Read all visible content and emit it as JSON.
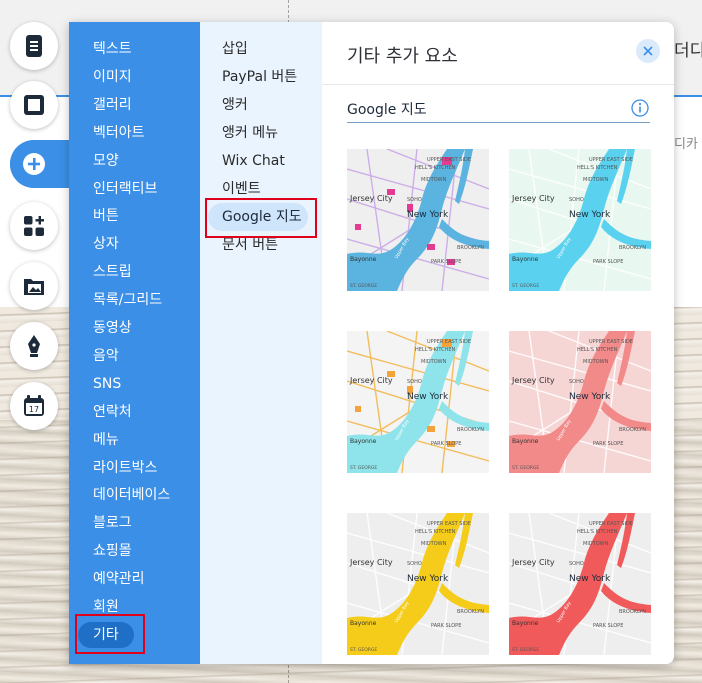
{
  "background": {
    "partial_text_top": "더디",
    "partial_text_mid": "디카"
  },
  "toolbar": {
    "buttons": [
      {
        "name": "pages-icon"
      },
      {
        "name": "background-icon"
      },
      {
        "name": "add-icon"
      },
      {
        "name": "app-market-icon"
      },
      {
        "name": "media-icon"
      },
      {
        "name": "pen-icon"
      },
      {
        "name": "bookings-icon"
      }
    ],
    "calendar_day": "17"
  },
  "categories": [
    "텍스트",
    "이미지",
    "갤러리",
    "벡터아트",
    "모양",
    "인터랙티브",
    "버튼",
    "상자",
    "스트립",
    "목록/그리드",
    "동영상",
    "음악",
    "SNS",
    "연락처",
    "메뉴",
    "라이트박스",
    "데이터베이스",
    "블로그",
    "쇼핑몰",
    "예약관리",
    "회원",
    "기타"
  ],
  "selected_category": "기타",
  "subcategories": [
    "삽입",
    "PayPal 버튼",
    "앵커",
    "앵커 메뉴",
    "Wix Chat",
    "이벤트",
    "Google 지도",
    "문서 버튼"
  ],
  "selected_subcategory": "Google 지도",
  "panel": {
    "title": "기타 추가 요소",
    "section_title": "Google 지도"
  },
  "map_labels": {
    "hells_kitchen": "HELL'S KITCHEN",
    "upper_east": "UPPER EAST SIDE",
    "midtown": "MIDTOWN",
    "soho": "SOHO",
    "jersey": "Jersey City",
    "newyork": "New York",
    "brooklyn": "BROOKLYN",
    "park_slope": "PARK SLOPE",
    "bayonne": "Bayonne",
    "st_george": "ST. GEORGE",
    "upper_bay": "Upper Bay"
  },
  "map_styles": [
    {
      "name": "colorful-map",
      "water": "#5bb3e0",
      "land": "#efefef",
      "roads": "#c9a7e8",
      "accent": "#e23b91"
    },
    {
      "name": "light-blue-map",
      "water": "#5ad2ef",
      "land": "#e8f7ef",
      "roads": "#ffffff",
      "accent": "#9fe3c3"
    },
    {
      "name": "orange-blue-map",
      "water": "#8fe3ea",
      "land": "#f4f4f4",
      "roads": "#f2b84b",
      "accent": "#f4a23a"
    },
    {
      "name": "pink-map",
      "water": "#f28a8a",
      "land": "#f6d5d5",
      "roads": "#ffffff",
      "accent": "#f06f6f"
    },
    {
      "name": "yellow-map",
      "water": "#f5cc1a",
      "land": "#eeeeee",
      "roads": "#ffffff",
      "accent": "#f5cc1a"
    },
    {
      "name": "red-map",
      "water": "#f05a5a",
      "land": "#eeeeee",
      "roads": "#ffffff",
      "accent": "#f05a5a"
    }
  ]
}
